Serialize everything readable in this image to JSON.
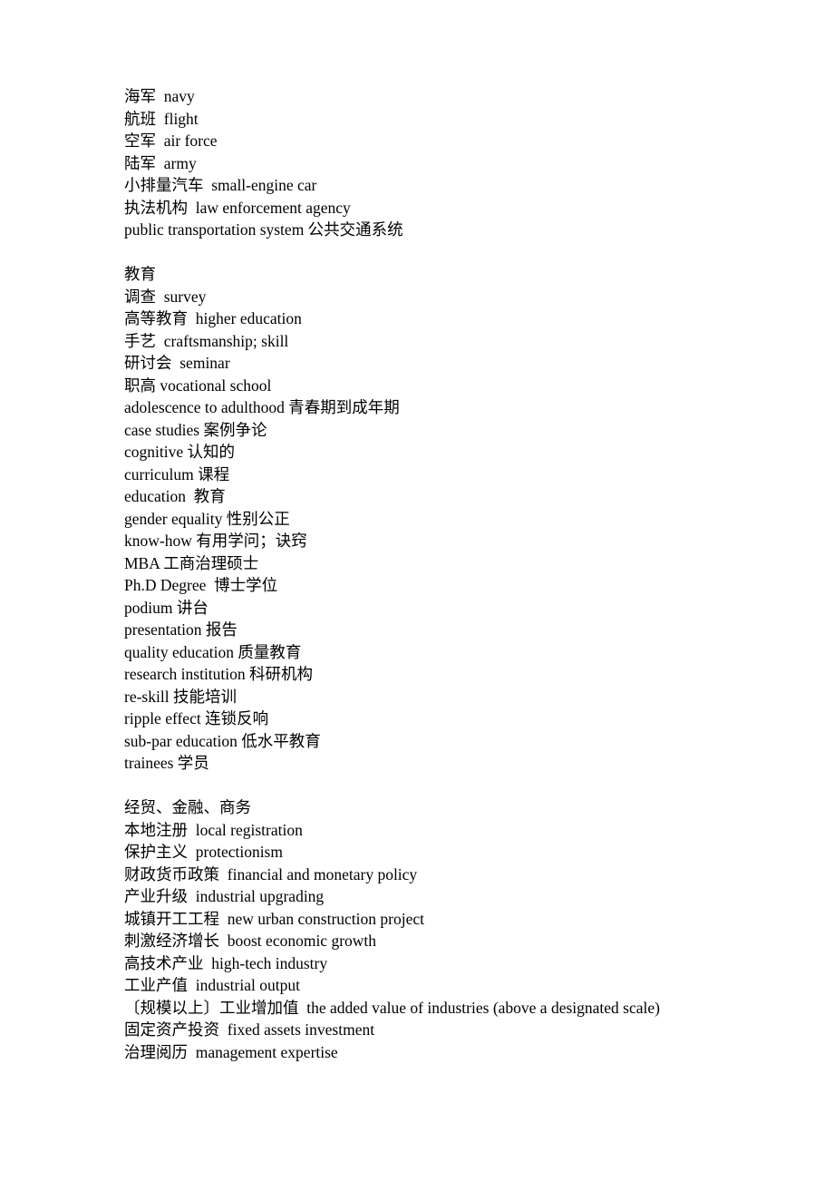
{
  "document": {
    "title": "Chinese-English Glossary",
    "page_background": "#ffffff",
    "text_color": "#000000",
    "blocks": [
      {
        "id": "transport-military",
        "lines": [
          "海军  navy",
          "航班  flight",
          "空军  air force",
          "陆军  army",
          "小排量汽车  small-engine car",
          "执法机构  law enforcement agency",
          "public transportation system 公共交通系统"
        ]
      },
      {
        "id": "education",
        "lines": [
          "教育",
          "调查  survey",
          "高等教育  higher education",
          "手艺  craftsmanship; skill",
          "研讨会  seminar",
          "职高 vocational school",
          "adolescence to adulthood 青春期到成年期",
          "case studies 案例争论",
          "cognitive 认知的",
          "curriculum 课程",
          "education  教育",
          "gender equality 性别公正",
          "know-how 有用学问；诀窍",
          "MBA 工商治理硕士",
          "Ph.D Degree  博士学位",
          "podium 讲台",
          "presentation 报告",
          "quality education 质量教育",
          "research institution 科研机构",
          "re-skill 技能培训",
          "ripple effect 连锁反响",
          "sub-par education 低水平教育",
          "trainees 学员"
        ]
      },
      {
        "id": "economy-finance-business",
        "lines": [
          "经贸、金融、商务",
          "本地注册  local registration",
          "保护主义  protectionism",
          "财政货币政策  financial and monetary policy",
          "产业升级  industrial upgrading",
          "城镇开工工程  new urban construction project",
          "刺激经济增长  boost economic growth",
          "高技术产业  high-tech industry",
          "工业产值  industrial output",
          "〔规模以上〕工业增加值  the added value of industries (above a designated scale)",
          "固定资产投资  fixed assets investment",
          "治理阅历  management expertise"
        ]
      }
    ]
  }
}
